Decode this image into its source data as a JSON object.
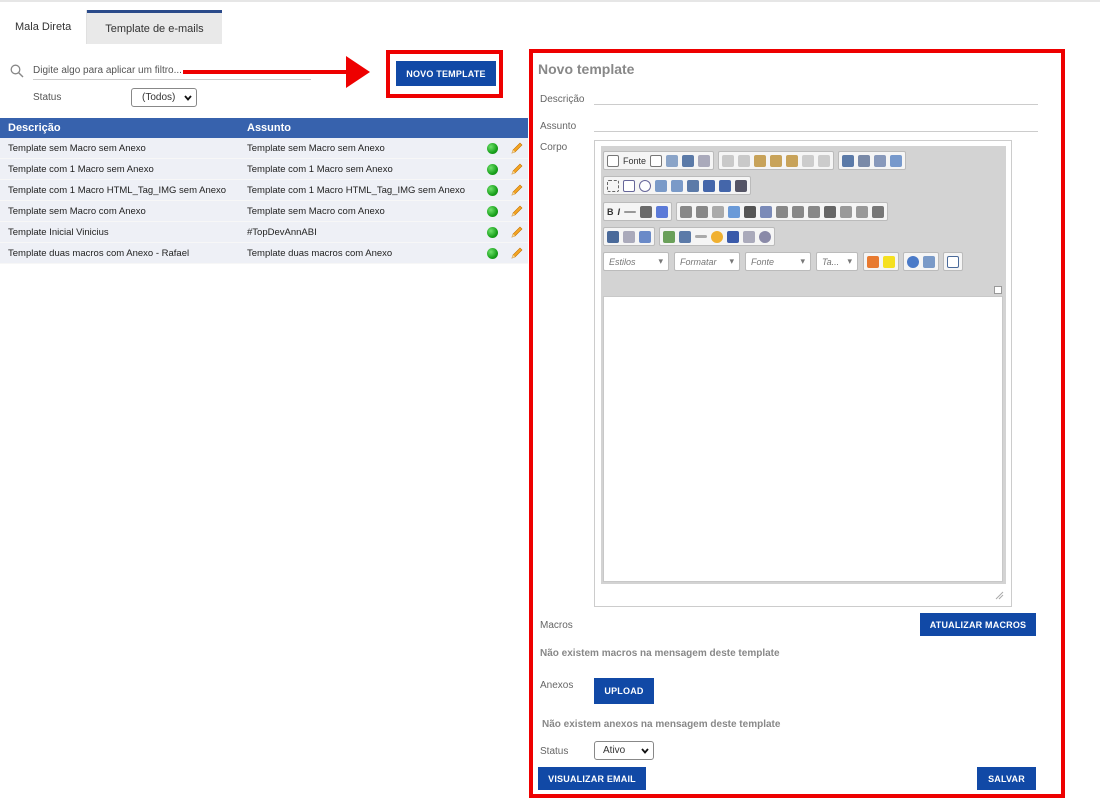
{
  "tabs": [
    {
      "label": "Mala Direta",
      "active": false
    },
    {
      "label": "Template de e-mails",
      "active": true
    }
  ],
  "filter": {
    "placeholder": "Digite algo para aplicar um filtro...",
    "status_label": "Status",
    "status_value": "(Todos)"
  },
  "new_template_button": "NOVO TEMPLATE",
  "table": {
    "headers": [
      "Descrição",
      "Assunto"
    ],
    "rows": [
      {
        "descricao": "Template sem Macro sem Anexo",
        "assunto": "Template sem Macro sem Anexo"
      },
      {
        "descricao": "Template com 1 Macro sem Anexo",
        "assunto": "Template com 1 Macro sem Anexo"
      },
      {
        "descricao": "Template com 1 Macro HTML_Tag_IMG sem Anexo",
        "assunto": "Template com 1 Macro HTML_Tag_IMG sem Anexo"
      },
      {
        "descricao": "Template sem Macro com Anexo",
        "assunto": "Template sem Macro com Anexo"
      },
      {
        "descricao": "Template Inicial Vinicius",
        "assunto": "#TopDevAnnABI"
      },
      {
        "descricao": "Template duas macros com Anexo - Rafael",
        "assunto": "Template duas macros com Anexo"
      }
    ],
    "status_color": "#19a11c",
    "edit_color": "#f5a623"
  },
  "form": {
    "title": "Novo template",
    "descricao_label": "Descrição",
    "assunto_label": "Assunto",
    "corpo_label": "Corpo",
    "macros_label": "Macros",
    "update_macros_button": "ATUALIZAR MACROS",
    "no_macros_msg": "Não existem macros na mensagem deste template",
    "anexos_label": "Anexos",
    "upload_button": "UPLOAD",
    "no_attachments_msg": "Não existem anexos na mensagem deste template",
    "status_label": "Status",
    "status_value": "Ativo",
    "preview_button": "VISUALIZAR EMAIL",
    "save_button": "SALVAR"
  },
  "editor": {
    "source_label": "Fonte",
    "bold": "B",
    "italic": "I",
    "combos": [
      "Estilos",
      "Formatar",
      "Fonte",
      "Ta..."
    ]
  },
  "colors": {
    "accent": "#1149a6",
    "table_header": "#3762ad",
    "annotation": "#ee0000"
  }
}
